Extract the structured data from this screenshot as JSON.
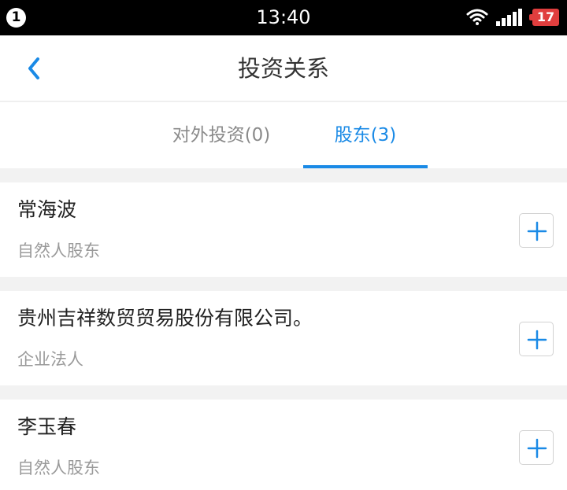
{
  "status_bar": {
    "notification_count": "1",
    "time": "13:40",
    "battery": "17",
    "icons": [
      "wifi-icon",
      "signal-icon",
      "battery-icon"
    ]
  },
  "nav": {
    "title": "投资关系",
    "back_icon": "chevron-left-icon"
  },
  "tabs": [
    {
      "label": "对外投资(0)",
      "active": false
    },
    {
      "label": "股东(3)",
      "active": true
    }
  ],
  "shareholders": [
    {
      "name": "常海波",
      "type": "自然人股东"
    },
    {
      "name": "贵州吉祥数贸贸易股份有限公司。",
      "type": "企业法人"
    },
    {
      "name": "李玉春",
      "type": "自然人股东"
    }
  ],
  "colors": {
    "accent": "#1a8ae6",
    "status_bar_bg": "#000000",
    "battery_low": "#e03e3e",
    "page_bg": "#f2f2f2"
  }
}
